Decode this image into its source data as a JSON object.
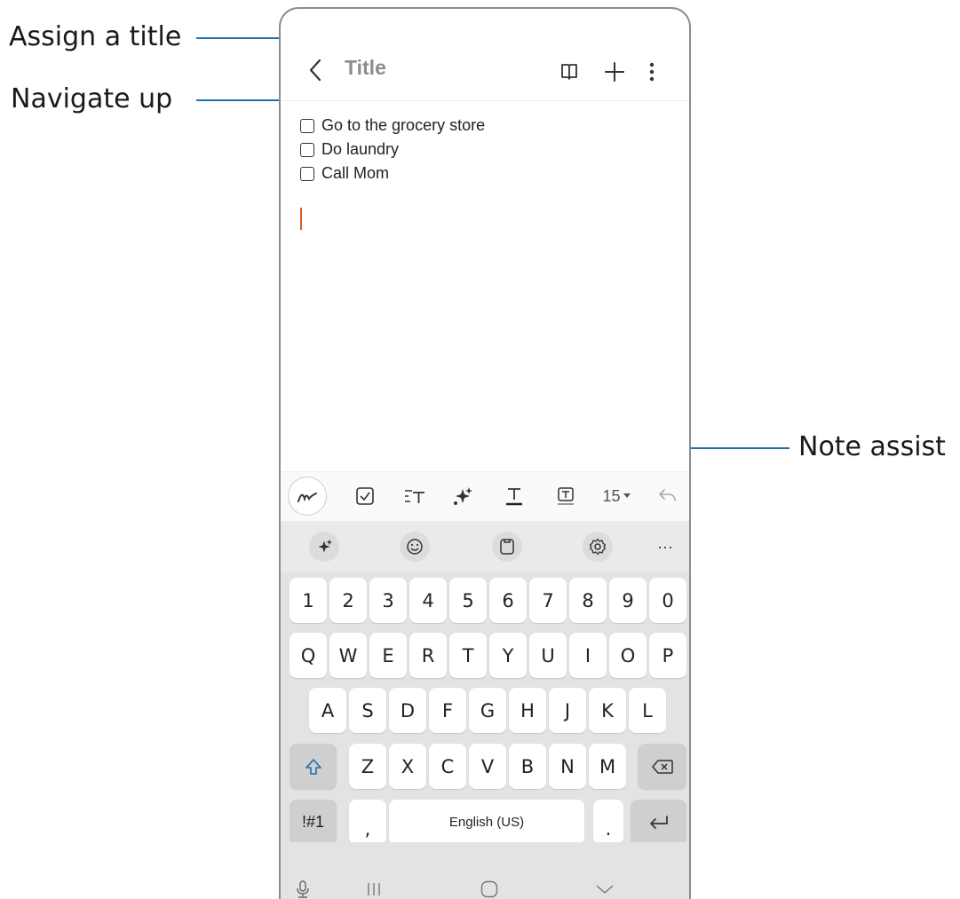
{
  "callouts": {
    "assign_title": "Assign a title",
    "navigate_up": "Navigate up",
    "note_assist": "Note assist"
  },
  "appbar": {
    "title_placeholder": "Title",
    "icons": [
      "back-icon",
      "reading-mode-icon",
      "add-icon",
      "more-options-icon"
    ]
  },
  "checklist": [
    {
      "label": "Go to the grocery store",
      "checked": false
    },
    {
      "label": "Do laundry",
      "checked": false
    },
    {
      "label": "Call Mom",
      "checked": false
    }
  ],
  "toolbar": {
    "font_size": "15",
    "icons": [
      "handwriting-icon",
      "checkbox-icon",
      "text-style-icon",
      "note-assist-icon",
      "text-color-icon",
      "highlight-icon",
      "font-size-dropdown",
      "undo-icon"
    ]
  },
  "suggestion_bar": {
    "icons": [
      "galaxy-ai-icon",
      "emoji-icon",
      "clipboard-icon",
      "settings-icon",
      "more-icon"
    ],
    "more_label": "···"
  },
  "keyboard": {
    "row_numbers": [
      "1",
      "2",
      "3",
      "4",
      "5",
      "6",
      "7",
      "8",
      "9",
      "0"
    ],
    "row_top": [
      "Q",
      "W",
      "E",
      "R",
      "T",
      "Y",
      "U",
      "I",
      "O",
      "P"
    ],
    "row_mid": [
      "A",
      "S",
      "D",
      "F",
      "G",
      "H",
      "J",
      "K",
      "L"
    ],
    "row_bottom": [
      "Z",
      "X",
      "C",
      "V",
      "B",
      "N",
      "M"
    ],
    "symbols_key": "!#1",
    "comma_key": ",",
    "space_key": "English (US)",
    "period_key": "."
  },
  "colors": {
    "callout_line": "#1f6fa8",
    "title_placeholder": "#8d8d8d",
    "cursor": "#e0572a",
    "shift_icon": "#1f6fa8"
  }
}
